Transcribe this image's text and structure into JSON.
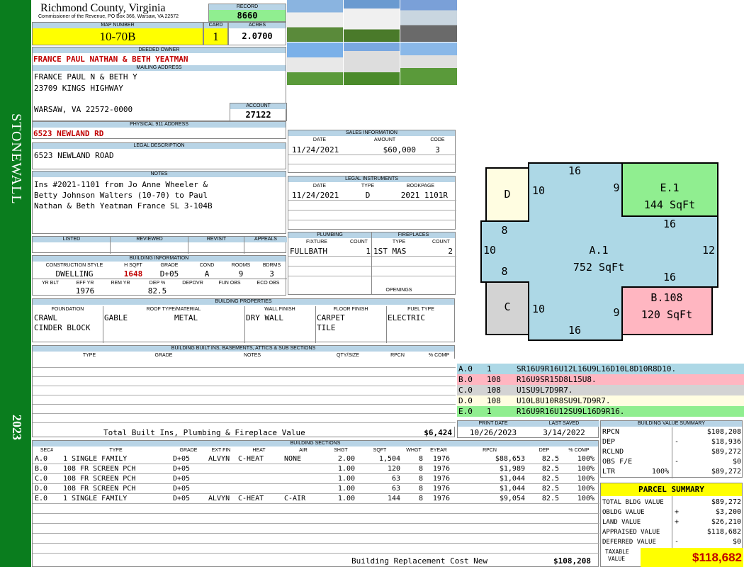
{
  "sidebar": {
    "district": "STONEWALL",
    "year": "2023"
  },
  "header": {
    "county": "Richmond County, Virginia",
    "commissioner": "Commissioner of the Revenue, PO Box 366, Warsaw, VA 22572",
    "record_label": "RECORD",
    "record": "8660",
    "map_label": "MAP NUMBER",
    "map": "10-70B",
    "card_label": "CARD",
    "card": "1",
    "acres_label": "ACRES",
    "acres": "2.0700"
  },
  "owner": {
    "deeded_label": "DEEDED OWNER",
    "deeded": "FRANCE PAUL NATHAN & BETH YEATMAN",
    "mailing_label": "MAILING ADDRESS",
    "mail1": "FRANCE PAUL N & BETH Y",
    "mail2": "23709 KINGS HIGHWAY",
    "mail3": "WARSAW, VA 22572-0000",
    "account_label": "ACCOUNT",
    "account": "27122",
    "physical_label": "PHYSICAL 911 ADDRESS",
    "physical": "6523 NEWLAND RD",
    "legal_label": "LEGAL DESCRIPTION",
    "legal": "6523 NEWLAND ROAD",
    "notes_label": "NOTES",
    "note1": "Ins #2021-1101 from Jo Anne Wheeler &",
    "note2": "Betty Johnson Walters (10-70) to Paul",
    "note3": "Nathan & Beth Yeatman France SL 3-104B"
  },
  "review": {
    "listed": "LISTED",
    "reviewed": "REVIEWED",
    "revisit": "REVISIT",
    "appeals": "APPEALS"
  },
  "building_info": {
    "title": "BUILDING INFORMATION",
    "h1": "CONSTRUCTION STYLE",
    "h2": "H SQFT",
    "h3": "GRADE",
    "h4": "COND",
    "h5": "ROOMS",
    "h6": "BDRMS",
    "style": "DWELLING",
    "hsqft": "1648",
    "grade": "D+05",
    "cond": "A",
    "rooms": "9",
    "bdrms": "3",
    "h7": "YR BLT",
    "h8": "EFF YR",
    "h9": "REM YR",
    "h10": "DEP %",
    "h11": "DEPOVR",
    "h12": "FUN OBS",
    "h13": "ECO OBS",
    "effyr": "1976",
    "dep": "82.5"
  },
  "sales": {
    "title": "SALES INFORMATION",
    "h1": "DATE",
    "h2": "AMOUNT",
    "h3": "CODE",
    "date": "11/24/2021",
    "amount": "$60,000",
    "code": "3"
  },
  "legal_instr": {
    "title": "LEGAL INSTRUMENTS",
    "h1": "DATE",
    "h2": "TYPE",
    "h3": "BOOKPAGE",
    "date": "11/24/2021",
    "type": "D",
    "bookpage": "2021 1101R"
  },
  "plumbing": {
    "title": "PLUMBING",
    "h1": "FIXTURE",
    "h2": "COUNT",
    "fixture": "FULLBATH",
    "count": "1"
  },
  "fireplaces": {
    "title": "FIREPLACES",
    "h1": "TYPE",
    "h2": "COUNT",
    "type": "1ST MAS",
    "count": "2",
    "openings": "OPENINGS"
  },
  "properties": {
    "title": "BUILDING PROPERTIES",
    "h1": "FOUNDATION",
    "h2": "ROOF TYPE/MATERIAL",
    "h3": "WALL FINISH",
    "h4": "FLOOR FINISH",
    "h5": "FUEL TYPE",
    "found1": "CRAWL",
    "found2": "CINDER BLOCK",
    "roof1": "GABLE",
    "roof2": "METAL",
    "wall": "DRY WALL",
    "floor1": "CARPET",
    "floor2": "TILE",
    "fuel": "ELECTRIC"
  },
  "builtins": {
    "title": "BUILDING BUILT INS, BASEMENTS, ATTICS & SUB SECTIONS",
    "h1": "TYPE",
    "h2": "GRADE",
    "h3": "NOTES",
    "h4": "QTY/SIZE",
    "h5": "RPCN",
    "h6": "% COMP",
    "total_label": "Total Built Ins, Plumbing & Fireplace Value",
    "total": "$6,424"
  },
  "print": {
    "h1": "PRINT DATE",
    "h2": "LAST SAVED",
    "print_date": "10/26/2023",
    "last_saved": "3/14/2022"
  },
  "sections": {
    "title": "BUILDING SECTIONS",
    "headers": [
      "SEC#",
      "TYPE",
      "GRADE",
      "EXT FIN",
      "HEAT",
      "AIR",
      "SHGT",
      "SQFT",
      "WHGT",
      "EYEAR",
      "RPCN",
      "DEP",
      "% COMP"
    ],
    "rows": [
      [
        "A.0",
        "1 SINGLE FAMILY",
        "D+05",
        "ALVYN",
        "C-HEAT",
        "NONE",
        "2.00",
        "1,504",
        "8",
        "1976",
        "$88,653",
        "82.5",
        "100%"
      ],
      [
        "B.0",
        "108 FR SCREEN PCH",
        "D+05",
        "",
        "",
        "",
        "1.00",
        "120",
        "8",
        "1976",
        "$1,989",
        "82.5",
        "100%"
      ],
      [
        "C.0",
        "108 FR SCREEN PCH",
        "D+05",
        "",
        "",
        "",
        "1.00",
        "63",
        "8",
        "1976",
        "$1,044",
        "82.5",
        "100%"
      ],
      [
        "D.0",
        "108 FR SCREEN PCH",
        "D+05",
        "",
        "",
        "",
        "1.00",
        "63",
        "8",
        "1976",
        "$1,044",
        "82.5",
        "100%"
      ],
      [
        "E.0",
        "1 SINGLE FAMILY",
        "D+05",
        "ALVYN",
        "C-HEAT",
        "C-AIR",
        "1.00",
        "144",
        "8",
        "1976",
        "$9,054",
        "82.5",
        "100%"
      ]
    ],
    "replacement_label": "Building Replacement Cost New",
    "replacement": "$108,208"
  },
  "sketch": {
    "a_name": "A.1",
    "a_area": "752 SqFt",
    "b_name": "B.108",
    "b_area": "120 SqFt",
    "e_name": "E.1",
    "e_area": "144 SqFt",
    "c_name": "C",
    "d_name": "D",
    "dims": [
      "16",
      "10",
      "9",
      "8",
      "10",
      "8",
      "12",
      "16",
      "16",
      "10",
      "9",
      "16"
    ],
    "colors": {
      "a": "#add8e6",
      "b": "#ffb6c1",
      "c": "#d3d3d3",
      "d": "#fffde1",
      "e": "#90ee90"
    }
  },
  "legend": [
    {
      "sec": "A.0",
      "code": "1",
      "path": "SR16U9R16U12L16U9L16D10L8D10R8D10.",
      "color": "#add8e6"
    },
    {
      "sec": "B.0",
      "code": "108",
      "path": "R16U9SR15D8L15U8.",
      "color": "#ffb6c1"
    },
    {
      "sec": "C.0",
      "code": "108",
      "path": "U1SU9L7D9R7.",
      "color": "#d3d3d3"
    },
    {
      "sec": "D.0",
      "code": "108",
      "path": "U10L8U10R8SU9L7D9R7.",
      "color": "#fffde1"
    },
    {
      "sec": "E.0",
      "code": "1",
      "path": "R16U9R16U12SU9L16D9R16.",
      "color": "#90ee90"
    }
  ],
  "value_summary": {
    "title": "BUILDING VALUE SUMMARY",
    "rpcn_label": "RPCN",
    "rpcn": "$108,208",
    "dep_label": "DEP",
    "dep_sign": "-",
    "dep": "$18,936",
    "rclnd_label": "RCLND",
    "rclnd": "$89,272",
    "obs_label": "OBS F/E",
    "obs_sign": "-",
    "obs": "$0",
    "ltr_label": "LTR",
    "ltr_pct": "100%",
    "ltr": "$89,272"
  },
  "parcel": {
    "title": "PARCEL SUMMARY",
    "bldg_label": "TOTAL BLDG VALUE",
    "bldg": "$89,272",
    "obldg_label": "OBLDG VALUE",
    "obldg_sign": "+",
    "obldg": "$3,200",
    "land_label": "LAND VALUE",
    "land_sign": "+",
    "land": "$26,210",
    "appraised_label": "APPRAISED VALUE",
    "appraised": "$118,682",
    "deferred_label": "DEFERRED VALUE",
    "deferred_sign": "-",
    "deferred": "$0",
    "taxable_label1": "TAXABLE",
    "taxable_label2": "VALUE",
    "taxable": "$118,682"
  }
}
